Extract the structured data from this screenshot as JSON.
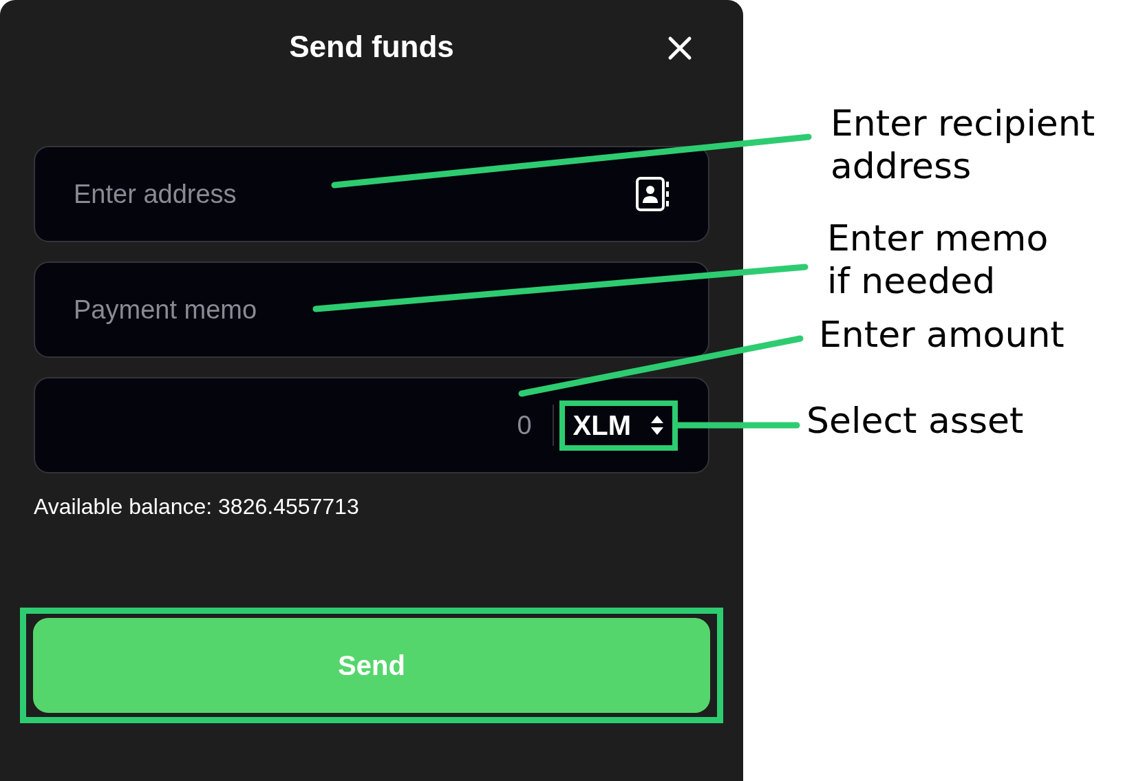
{
  "dialog": {
    "title": "Send funds"
  },
  "fields": [
    {
      "kind": "address",
      "placeholder": "Enter address"
    },
    {
      "kind": "memo",
      "placeholder": "Payment memo"
    }
  ],
  "amount": {
    "placeholder": "0",
    "asset": "XLM",
    "asset_highlighted": true
  },
  "balance": "Available balance: 3826.4557713",
  "send": {
    "label": "Send",
    "highlighted": true
  },
  "annotations": [
    {
      "lines": [
        "Enter recipient",
        "address"
      ]
    },
    {
      "lines": [
        "Enter memo",
        "if needed"
      ]
    },
    {
      "lines": [
        "Enter amount"
      ]
    },
    {
      "lines": [
        "Select asset"
      ]
    }
  ]
}
